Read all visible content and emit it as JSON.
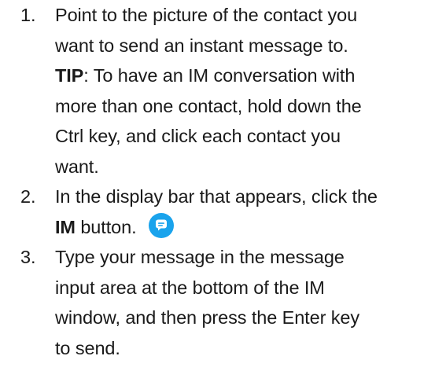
{
  "steps": [
    {
      "number": "1.",
      "lines": [
        "Point to the picture of the contact you",
        "want to send an instant message to."
      ],
      "tip_label": "TIP",
      "tip_lines": [
        ": To have an IM conversation with",
        "more than one contact, hold down the",
        "Ctrl key, and click each contact you",
        "want."
      ]
    },
    {
      "number": "2.",
      "line1": "In the display bar that appears, click the",
      "bold_word": "IM",
      "after_bold": " button.",
      "icon": "chat-bubble-icon"
    },
    {
      "number": "3.",
      "lines": [
        "Type your message in the message",
        "input area at the bottom of the IM",
        "window, and then press the Enter key",
        "to send."
      ]
    }
  ],
  "colors": {
    "icon_fill": "#1aa3ec",
    "icon_glyph": "#ffffff",
    "text": "#1a1a1a"
  }
}
